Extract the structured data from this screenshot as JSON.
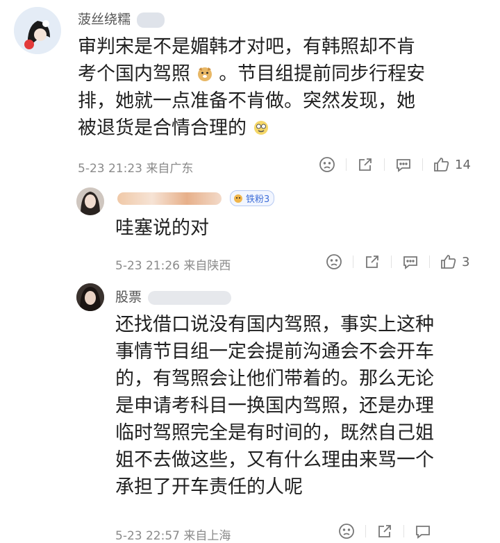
{
  "comments": [
    {
      "name": "菠丝绕糯",
      "lines": [
        "审判宋是不是媚韩才对吧，有韩照却不肯",
        "考个国内驾照",
        "。节目组提前同步行程安",
        "排，她就一点准备不肯做。突然发现，她",
        "被退货是合情合理的"
      ],
      "time": "5-23 21:23 来自广东",
      "likes": "14"
    },
    {
      "name": "",
      "badge": "铁粉3",
      "lines": [
        "哇塞说的对"
      ],
      "time": "5-23 21:26 来自陕西",
      "likes": "3"
    },
    {
      "name": "股票",
      "lines": [
        "还找借口说没有国内驾照，事实上这种",
        "事情节目组一定会提前沟通会不会开车",
        "的，有驾照会让他们带着的。那么无论",
        "是申请考科目一换国内驾照，还是办理",
        "临时驾照完全是有时间的，既然自己姐",
        "姐不去做这些，又有什么理由来骂一个",
        "承担了开车责任的人呢"
      ],
      "time": "5-23 22:57 来自上海"
    }
  ],
  "icons": [
    "sad-face-icon",
    "share-icon",
    "comment-icon",
    "thumb-up-icon"
  ]
}
